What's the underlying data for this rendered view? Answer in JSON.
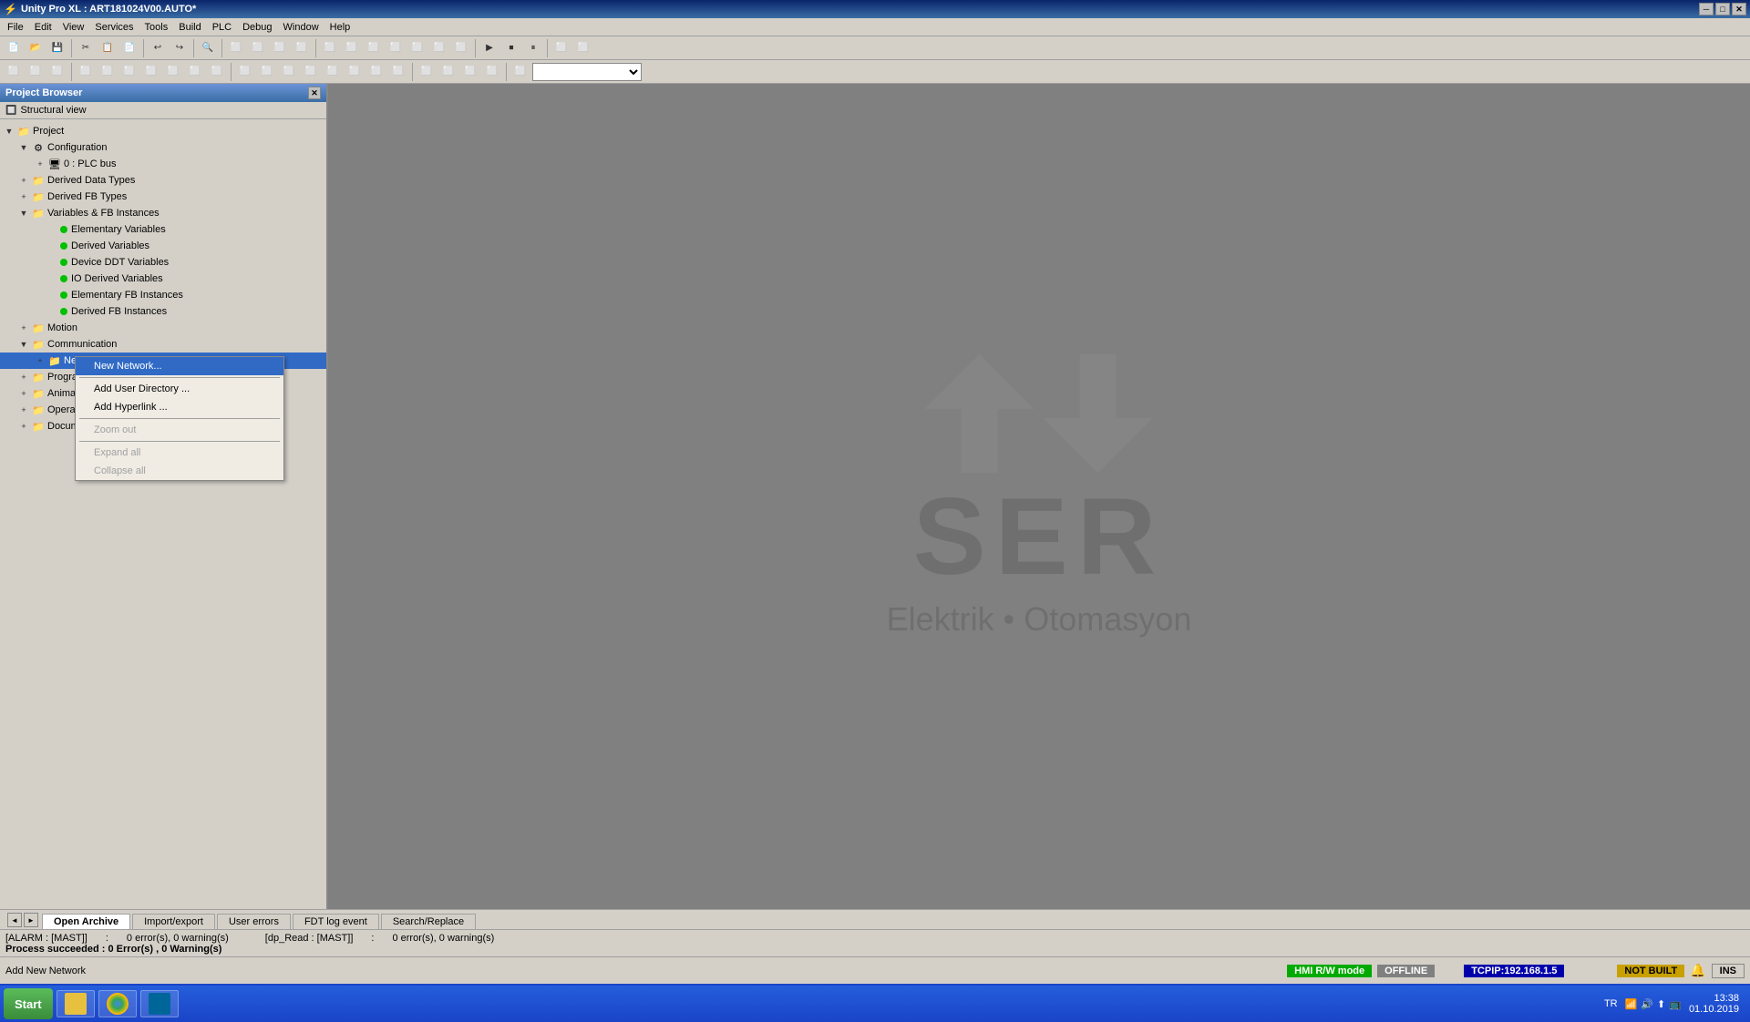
{
  "titlebar": {
    "title": "Unity Pro XL : ART181024V00.AUTO*",
    "minimize": "─",
    "maximize": "□",
    "close": "✕"
  },
  "menubar": {
    "items": [
      "File",
      "Edit",
      "View",
      "Services",
      "Tools",
      "Build",
      "PLC",
      "Debug",
      "Window",
      "Help"
    ]
  },
  "projectbrowser": {
    "title": "Project Browser",
    "structural_view": "Structural view",
    "tree": {
      "project": "Project",
      "configuration": "Configuration",
      "plcbus": "0 : PLC bus",
      "derivedDataTypes": "Derived Data Types",
      "derivedFBTypes": "Derived FB Types",
      "variablesFBInstances": "Variables & FB Instances",
      "elementaryVariables": "Elementary Variables",
      "derivedVariables": "Derived Variables",
      "deviceDDTVariables": "Device DDT Variables",
      "ioDerivedVariables": "IO Derived Variables",
      "elementaryFBInstances": "Elementary FB Instances",
      "derivedFBInstances": "Derived FB Instances",
      "motion": "Motion",
      "communication": "Communication",
      "networks": "Networks",
      "programs": "Program",
      "animation": "Animat",
      "operator": "Operat",
      "documentation": "Docum"
    }
  },
  "contextmenu": {
    "newNetwork": "New Network...",
    "addUserDirectory": "Add User Directory ...",
    "addHyperlink": "Add Hyperlink ...",
    "zoomOut": "Zoom out",
    "expandAll": "Expand all",
    "collapseAll": "Collapse all"
  },
  "serlogo": {
    "text": "SER",
    "subtitle": "Elektrik • Otomasyon"
  },
  "bottomtabs": {
    "tabs": [
      "Open Archive",
      "Import/export",
      "User errors",
      "FDT log event",
      "Search/Replace"
    ]
  },
  "statusbar": {
    "row1_label1": "[ALARM : [MAST]]",
    "row1_sep1": ":",
    "row1_val1": "0 error(s), 0 warning(s)",
    "row2_label1": "[dp_Read : [MAST]]",
    "row2_sep1": ":",
    "row2_val1": "0 error(s), 0 warning(s)",
    "row3": "Process succeeded : 0 Error(s) , 0 Warning(s)"
  },
  "statusbar2": {
    "add_network": "Add New Network",
    "hmi_rw_label": "HMI R/W mode",
    "offline": "OFFLINE",
    "tcpip": "TCPIP:192.168.1.5",
    "not_built": "NOT BUILT",
    "ins": "INS"
  },
  "taskbar": {
    "start": "Start",
    "tr": "TR",
    "time": "13:38",
    "date": "01.10.2019"
  },
  "toolbar1": {
    "buttons": [
      "📄",
      "📂",
      "💾",
      "✂",
      "📋",
      "📋",
      "↩",
      "↪",
      "🔍",
      "⬛",
      "⬛",
      "⬛",
      "⬛",
      "⬛",
      "⬛",
      "⬛",
      "⬛",
      "⬛",
      "⬛",
      "⬛",
      "⬛",
      "⬛",
      "⬛",
      "⬛",
      "⬛",
      "⬛",
      "⬛"
    ]
  }
}
